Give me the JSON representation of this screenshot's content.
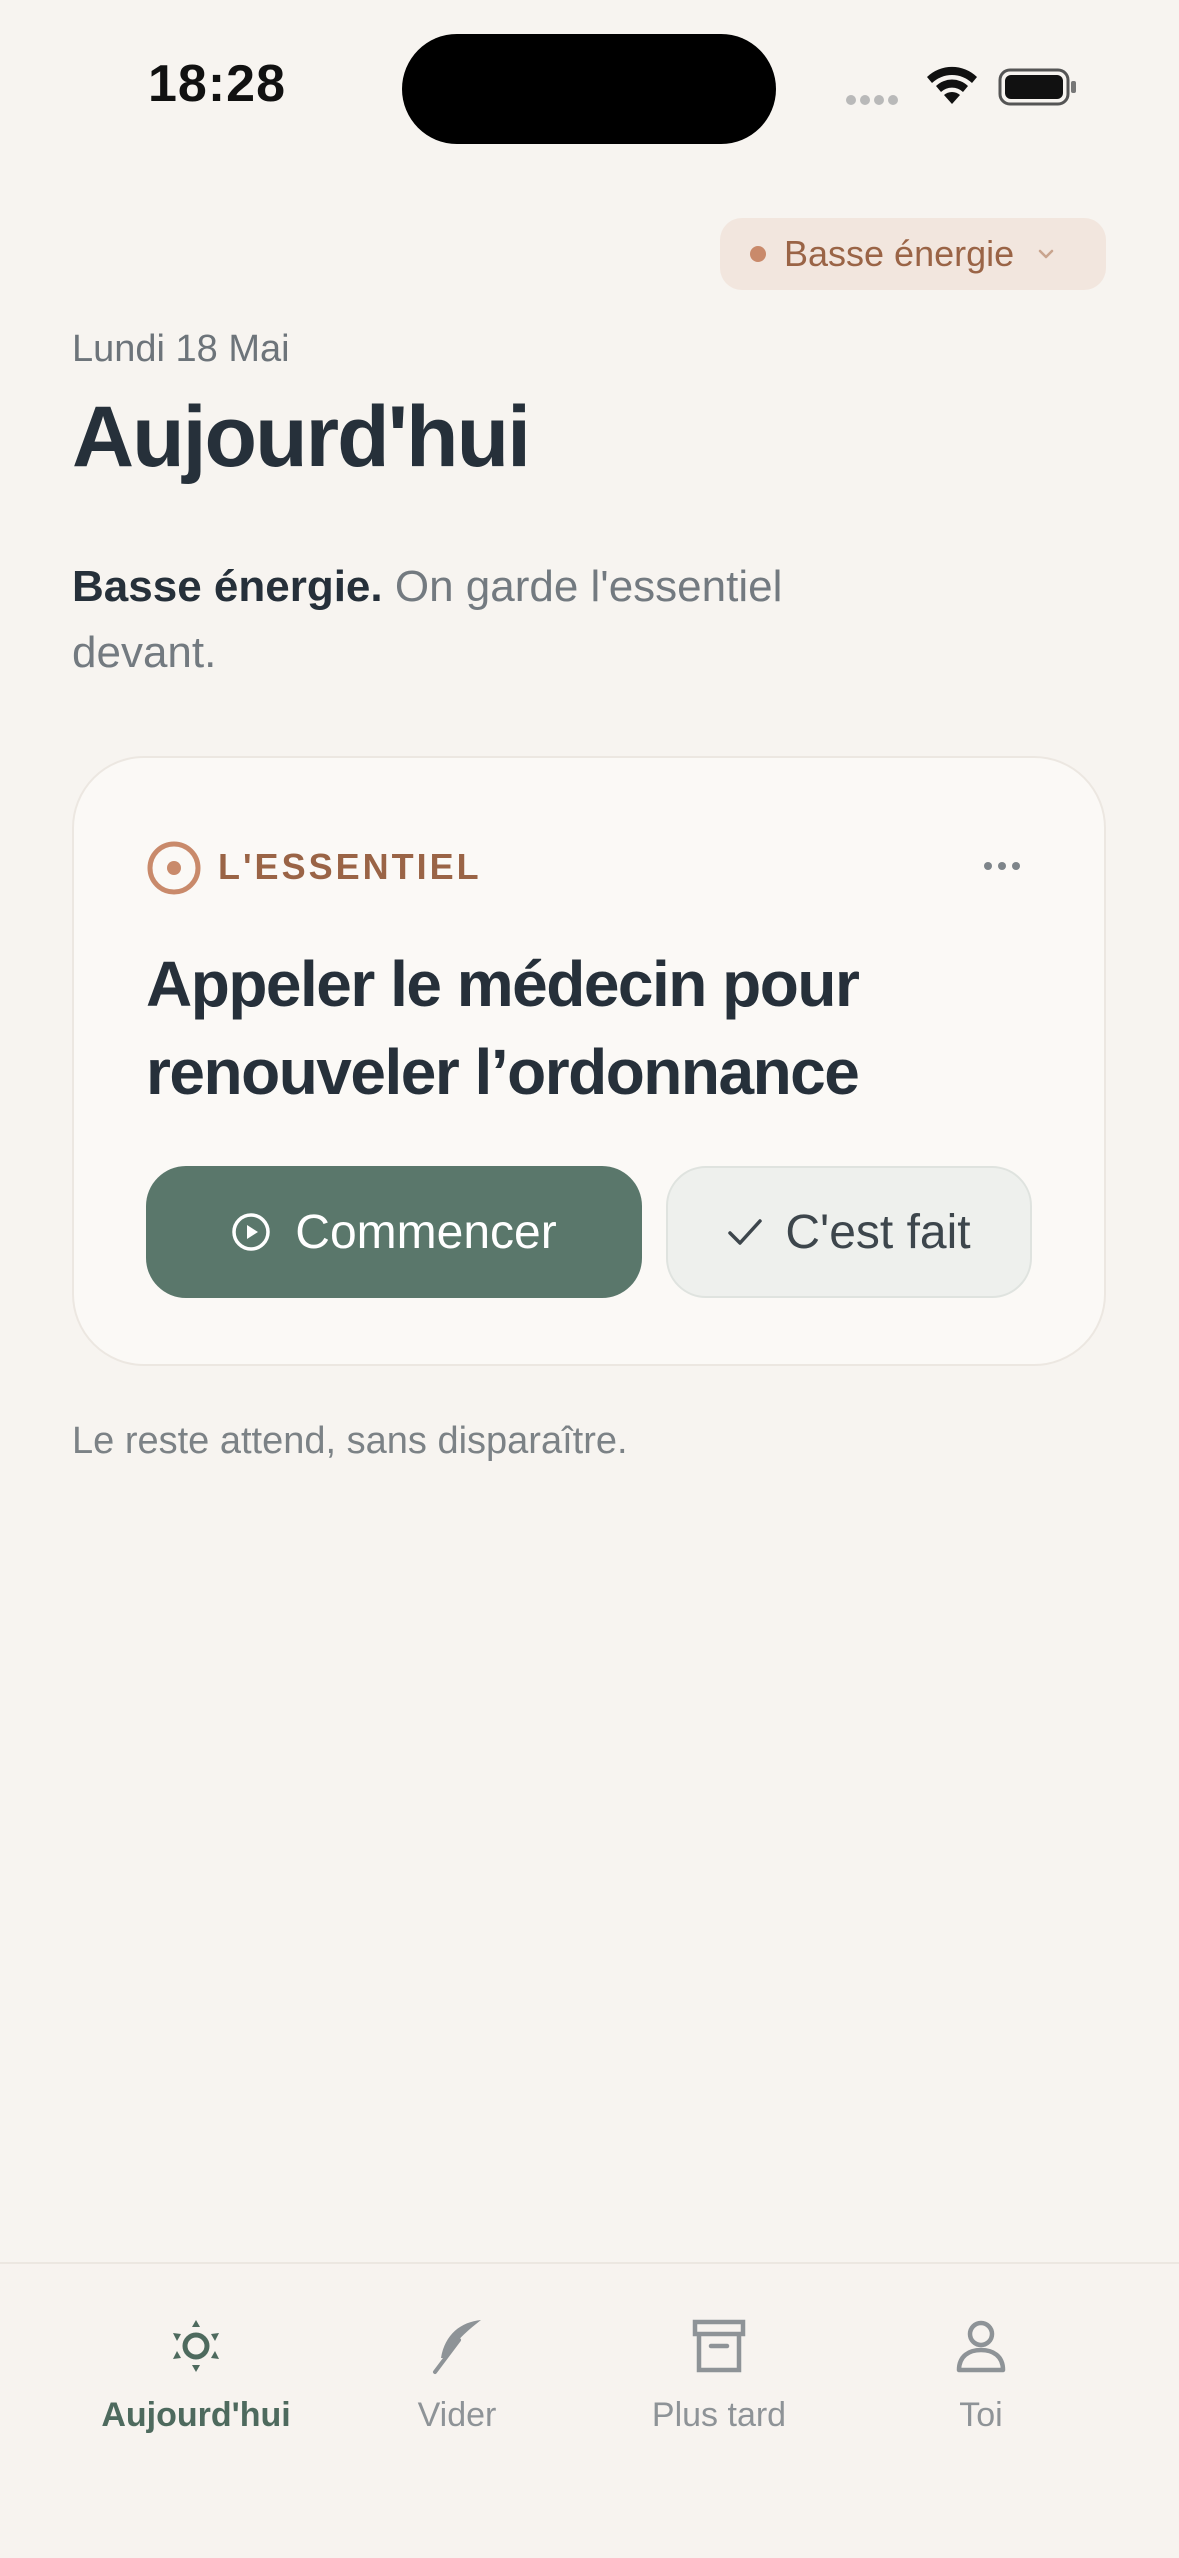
{
  "status_bar": {
    "time": "18:28"
  },
  "energy_selector": {
    "label": "Basse énergie"
  },
  "header": {
    "date": "Lundi 18 Mai",
    "title": "Aujourd'hui"
  },
  "summary": {
    "bold": "Basse énergie.",
    "text": " On garde l'essentiel devant."
  },
  "focus_card": {
    "section_label": "L'ESSENTIEL",
    "task_title": "Appeler le médecin pour renouveler l’ordonnance",
    "start_label": "Commencer",
    "done_label": "C'est fait"
  },
  "footer_note": "Le reste attend, sans disparaître.",
  "tabs": [
    {
      "label": "Aujourd'hui",
      "icon": "sun-icon",
      "active": true
    },
    {
      "label": "Vider",
      "icon": "feather-icon",
      "active": false
    },
    {
      "label": "Plus tard",
      "icon": "archive-icon",
      "active": false
    },
    {
      "label": "Toi",
      "icon": "person-icon",
      "active": false
    }
  ],
  "colors": {
    "background": "#F7F4F0",
    "accent_green": "#5A776B",
    "accent_terracotta": "#9A6446",
    "text_dark": "#26303A"
  }
}
